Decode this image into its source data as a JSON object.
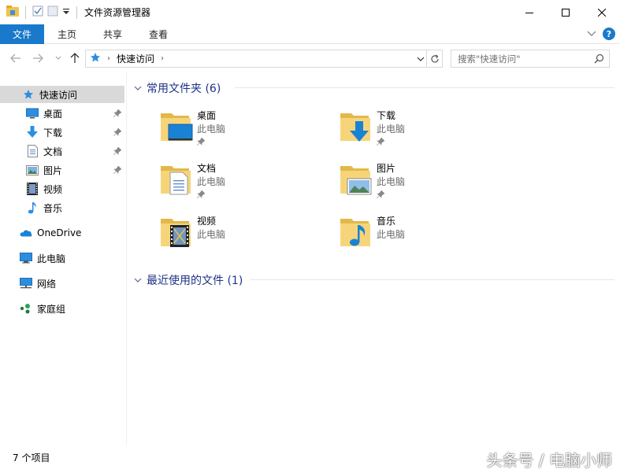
{
  "window": {
    "title": "文件资源管理器"
  },
  "ribbon": {
    "tabs": [
      {
        "label": "文件"
      },
      {
        "label": "主页"
      },
      {
        "label": "共享"
      },
      {
        "label": "查看"
      }
    ],
    "help_label": "?"
  },
  "address": {
    "crumb": "快速访问",
    "search_placeholder": "搜索\"快速访问\""
  },
  "nav": {
    "items": [
      {
        "label": "快速访问",
        "icon": "star-icon"
      },
      {
        "label": "桌面",
        "icon": "desktop-icon",
        "pinned": true
      },
      {
        "label": "下载",
        "icon": "download-icon",
        "pinned": true
      },
      {
        "label": "文档",
        "icon": "document-icon",
        "pinned": true
      },
      {
        "label": "图片",
        "icon": "picture-icon",
        "pinned": true
      },
      {
        "label": "视频",
        "icon": "video-icon"
      },
      {
        "label": "音乐",
        "icon": "music-icon"
      },
      {
        "label": "OneDrive",
        "icon": "cloud-icon"
      },
      {
        "label": "此电脑",
        "icon": "computer-icon"
      },
      {
        "label": "网络",
        "icon": "network-icon"
      },
      {
        "label": "家庭组",
        "icon": "homegroup-icon"
      }
    ]
  },
  "content": {
    "frequent_header": "常用文件夹 (6)",
    "recent_header": "最近使用的文件 (1)",
    "folders": [
      {
        "name": "桌面",
        "location": "此电脑",
        "overlay": "desktop-icon",
        "pinned": true
      },
      {
        "name": "下载",
        "location": "此电脑",
        "overlay": "download-icon",
        "pinned": true
      },
      {
        "name": "文档",
        "location": "此电脑",
        "overlay": "document-icon",
        "pinned": true
      },
      {
        "name": "图片",
        "location": "此电脑",
        "overlay": "picture-icon",
        "pinned": true
      },
      {
        "name": "视频",
        "location": "此电脑",
        "overlay": "video-icon",
        "pinned": false
      },
      {
        "name": "音乐",
        "location": "此电脑",
        "overlay": "music-icon",
        "pinned": false
      }
    ]
  },
  "status": {
    "item_count": "7 个项目"
  },
  "watermark": "头条号 / 电脑小师",
  "colors": {
    "accent": "#1979ca",
    "folder": "#f6d57a",
    "header_text": "#1e3287",
    "selected_bg": "#d9d9d9"
  }
}
